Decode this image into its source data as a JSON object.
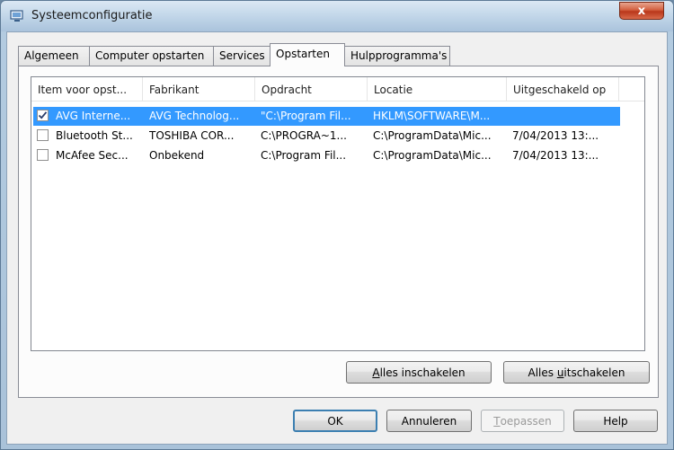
{
  "window": {
    "title": "Systeemconfiguratie",
    "close_label": "x"
  },
  "tabs": [
    {
      "label": "Algemeen"
    },
    {
      "label": "Computer opstarten"
    },
    {
      "label": "Services"
    },
    {
      "label": "Opstarten",
      "active": true
    },
    {
      "label": "Hulpprogramma's"
    }
  ],
  "columns": [
    "Item voor opst...",
    "Fabrikant",
    "Opdracht",
    "Locatie",
    "Uitgeschakeld op"
  ],
  "rows": [
    {
      "checked": true,
      "selected": true,
      "item": "AVG Interne...",
      "fabrikant": "AVG Technolog...",
      "opdracht": "\"C:\\Program Fil...",
      "locatie": "HKLM\\SOFTWARE\\M...",
      "uitgeschakeld": ""
    },
    {
      "checked": false,
      "selected": false,
      "item": "Bluetooth St...",
      "fabrikant": "TOSHIBA COR...",
      "opdracht": "C:\\PROGRA~1...",
      "locatie": "C:\\ProgramData\\Mic...",
      "uitgeschakeld": "7/04/2013 13:..."
    },
    {
      "checked": false,
      "selected": false,
      "item": "McAfee Sec...",
      "fabrikant": "Onbekend",
      "opdracht": "C:\\Program Fil...",
      "locatie": "C:\\ProgramData\\Mic...",
      "uitgeschakeld": "7/04/2013 13:..."
    }
  ],
  "panel_buttons": {
    "enable_all_accel": "A",
    "enable_all_rest": "lles inschakelen",
    "disable_all_pre": "Alles ",
    "disable_all_accel": "u",
    "disable_all_rest": "itschakelen"
  },
  "dialog_buttons": {
    "ok": "OK",
    "cancel": "Annuleren",
    "apply_accel": "T",
    "apply_rest": "oepassen",
    "help": "Help"
  },
  "colors": {
    "selection": "#3399ff",
    "default_button_border": "#3c7fb1"
  }
}
